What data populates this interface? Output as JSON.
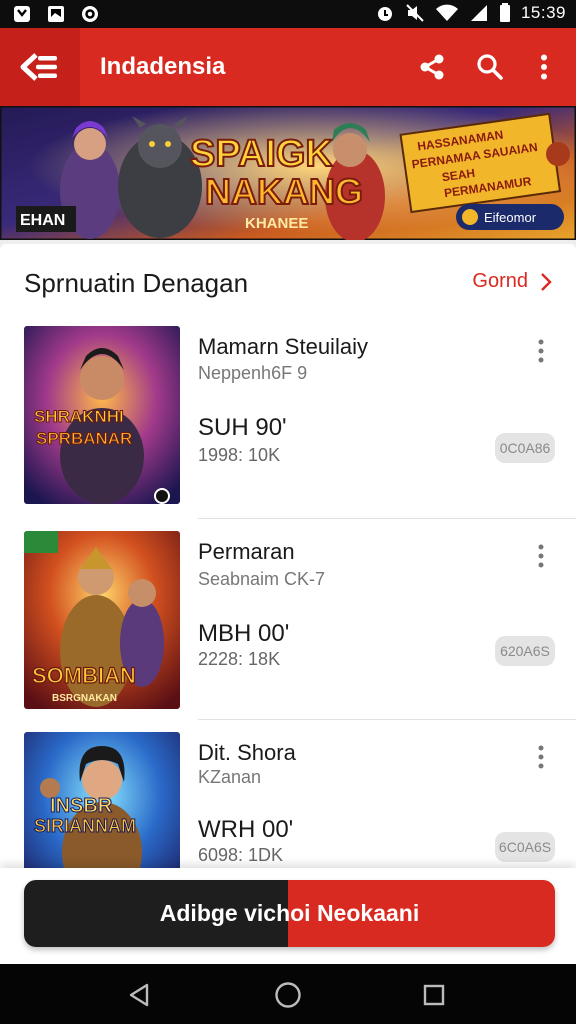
{
  "status_bar": {
    "time": "15:39",
    "left_icons": [
      "notification-icon",
      "photo-icon",
      "cast-icon"
    ],
    "right_icons": [
      "alarm-icon",
      "mute-icon",
      "wifi-icon",
      "signal-icon",
      "battery-icon"
    ]
  },
  "app_bar": {
    "title": "Indadensia",
    "actions": [
      "share-icon",
      "search-icon",
      "more-vert-icon"
    ]
  },
  "banner": {
    "headline_1": "SPAIGK",
    "headline_2": "NAKANG",
    "tagline": "KHANEE",
    "promo_lines": [
      "HASSANAMAN",
      "PERNAMAA SAUAIAN",
      "SEAH",
      "PERMANAMUR"
    ],
    "badge": "Eifeomor",
    "corner_label": "EHAN"
  },
  "section": {
    "title": "Sprnuatin Denagan",
    "see_more": "Gornd"
  },
  "items": [
    {
      "title": "Mamarn Steuilaiy",
      "subtitle": "Neppenh6F 9",
      "price": "SUH 90ʹ",
      "count": "1998: 10K",
      "pill": "0C0A86",
      "thumb_text_1": "SHRAKNHI",
      "thumb_text_2": "SPRBANAR"
    },
    {
      "title": "Permaran",
      "subtitle": "Seabnaim CK-7",
      "price": "MBH 00ʹ",
      "count": "2228: 18K",
      "pill": "620A6S",
      "thumb_text_1": "SOMBIAN",
      "thumb_text_2": "BSRGNAKAN"
    },
    {
      "title": "Dit. Shora",
      "subtitle": "KZanan",
      "price": "WRH 00ʹ",
      "count": "6098: 1DK",
      "pill": "6C0A6S",
      "thumb_text_1": "INSBR",
      "thumb_text_2": "SIRIANNAM"
    }
  ],
  "cta": {
    "label": "Adibge vichoi Neokaani"
  },
  "colors": {
    "brand_red": "#d92a22",
    "dark": "#1e1e1e"
  }
}
